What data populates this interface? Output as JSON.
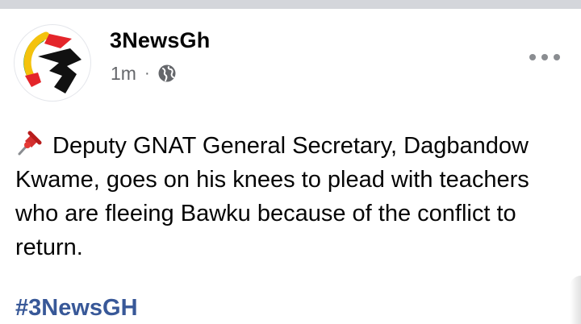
{
  "post": {
    "page_name": "3NewsGh",
    "timestamp": "1m",
    "separator": "·",
    "privacy_icon": "globe-icon",
    "more_icon": "more-horizontal-icon",
    "avatar_icon": "3news-logo",
    "body_icon": "pushpin-icon",
    "body_text": "Deputy GNAT General Secretary, Dagbandow Kwame, goes on his knees to plead with teachers who are fleeing Bawku because of the conflict to return.",
    "hashtag": "#3NewsGH"
  },
  "colors": {
    "divider": "#d4d6db",
    "secondary_text": "#65676b",
    "hashtag": "#385898",
    "logo_red": "#e4252a",
    "logo_yellow": "#f4c20d",
    "logo_green": "#1e9a3c",
    "logo_black": "#111111"
  }
}
